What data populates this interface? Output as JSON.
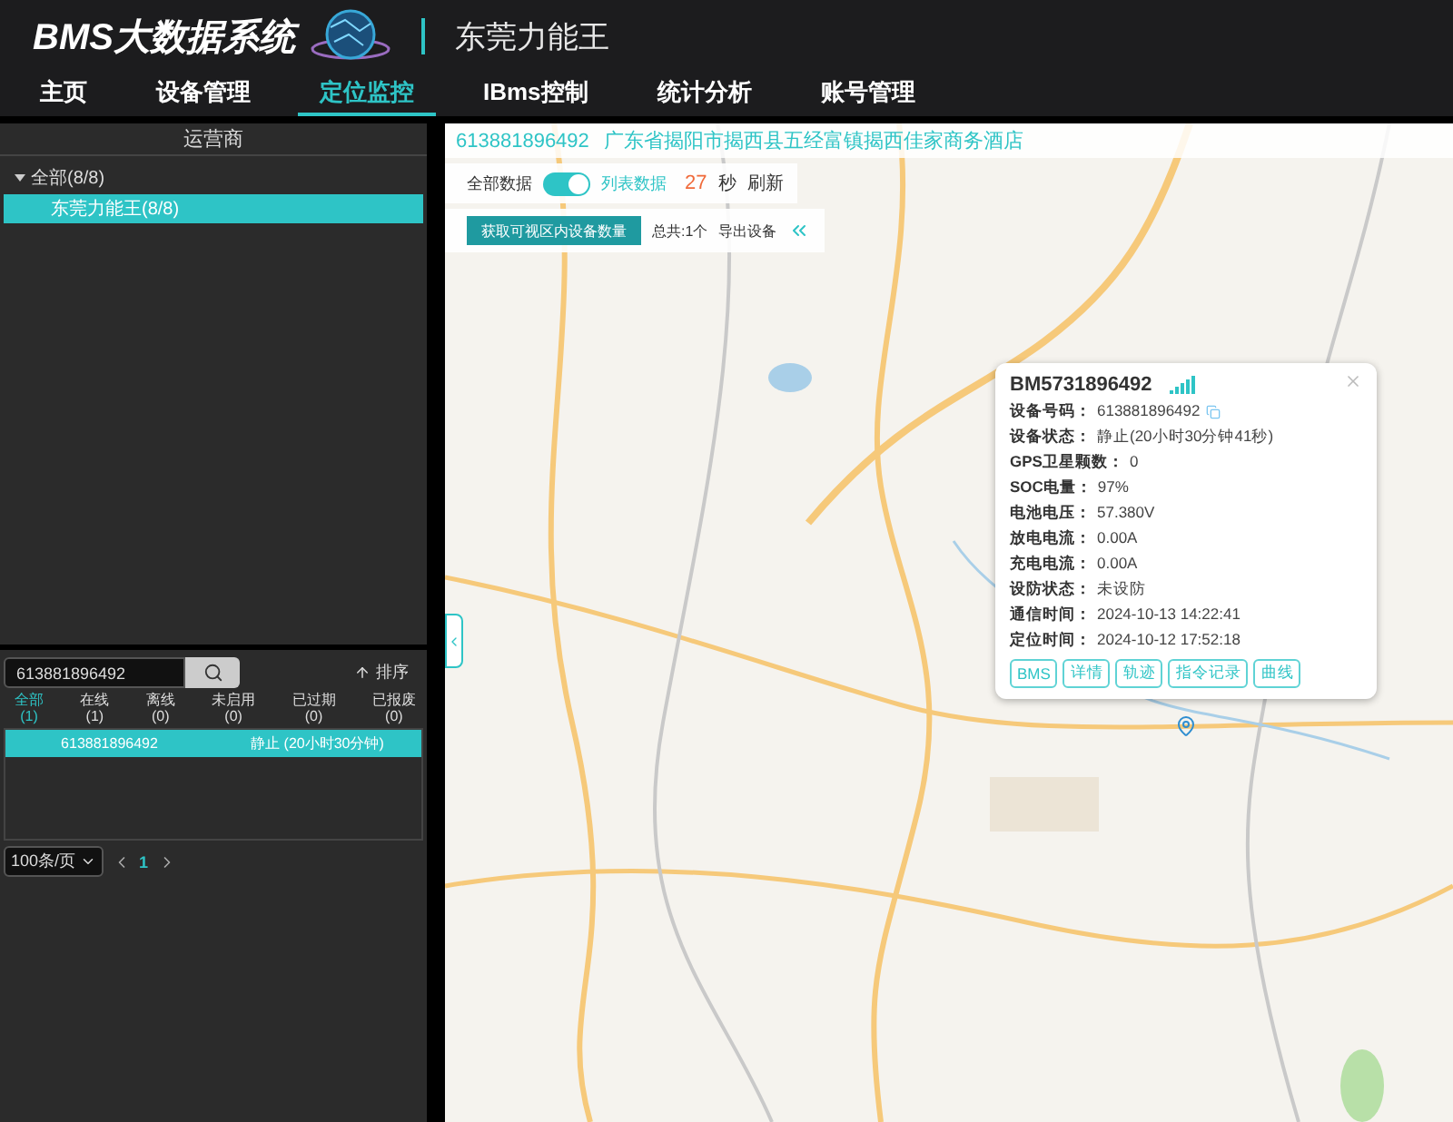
{
  "header": {
    "title": "BMS大数据系统",
    "company": "东莞力能王"
  },
  "nav": [
    {
      "label": "主页",
      "selected": false
    },
    {
      "label": "设备管理",
      "selected": false
    },
    {
      "label": "定位监控",
      "selected": true
    },
    {
      "label": "IBms控制",
      "selected": false
    },
    {
      "label": "统计分析",
      "selected": false
    },
    {
      "label": "账号管理",
      "selected": false
    }
  ],
  "operator_panel": {
    "title": "运营商",
    "tree": [
      {
        "label": "全部(8/8)",
        "expanded": true,
        "selected": false,
        "children": [
          {
            "label": "东莞力能王(8/8)",
            "selected": true
          }
        ]
      }
    ]
  },
  "device_panel": {
    "search": {
      "value": "613881896492"
    },
    "sort": "排序",
    "filters": [
      {
        "label": "全部",
        "count": "(1)",
        "selected": true
      },
      {
        "label": "在线",
        "count": "(1)",
        "selected": false
      },
      {
        "label": "离线",
        "count": "(0)",
        "selected": false
      },
      {
        "label": "未启用",
        "count": "(0)",
        "selected": false
      },
      {
        "label": "已过期",
        "count": "(0)",
        "selected": false
      },
      {
        "label": "已报废",
        "count": "(0)",
        "selected": false
      }
    ],
    "rows": [
      {
        "id": "613881896492",
        "status": "静止 (20小时30分钟)",
        "selected": true
      }
    ],
    "page_size": "100条/页",
    "page": "1"
  },
  "map": {
    "address_bar": {
      "device": "613881896492",
      "address": "广东省揭阳市揭西县五经富镇揭西佳家商务酒店"
    },
    "toggle": {
      "left": "全部数据",
      "right": "列表数据",
      "on": true
    },
    "countdown": "27",
    "unit": "秒",
    "refresh": "刷新",
    "fetch_button": "获取可视区内设备数量",
    "total": "总共:1个",
    "export": "导出设备",
    "popup": {
      "title": "BM5731896492",
      "fields": [
        {
          "label": "设备号码：",
          "value": "613881896492",
          "copy": true
        },
        {
          "label": "设备状态：",
          "value": "静止(20小时30分钟41秒)",
          "copy": false
        },
        {
          "label": "GPS卫星颗数：",
          "value": "0",
          "copy": false
        },
        {
          "label": "SOC电量：",
          "value": "97%",
          "copy": false
        },
        {
          "label": "电池电压：",
          "value": "57.380V",
          "copy": false
        },
        {
          "label": "放电电流：",
          "value": "0.00A",
          "copy": false
        },
        {
          "label": "充电电流：",
          "value": "0.00A",
          "copy": false
        },
        {
          "label": "设防状态：",
          "value": "未设防",
          "copy": false
        },
        {
          "label": "通信时间：",
          "value": "2024-10-13 14:22:41",
          "copy": false
        },
        {
          "label": "定位时间：",
          "value": "2024-10-12 17:52:18",
          "copy": false
        }
      ],
      "buttons": [
        "BMS",
        "详情",
        "轨迹",
        "指令记录",
        "曲线"
      ]
    }
  }
}
